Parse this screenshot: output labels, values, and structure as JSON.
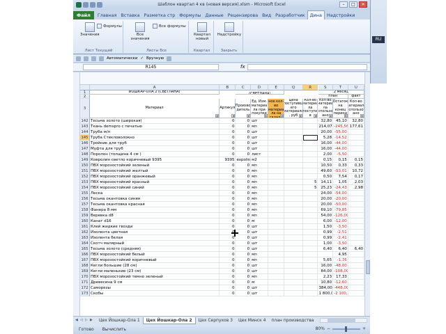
{
  "window": {
    "title": "Шаблон квартал  4 кв (новая версия).xlsm - Microsoft Excel",
    "language": "RU"
  },
  "tabs": [
    "Файл",
    "Главная",
    "Вставка",
    "Разметка стр",
    "Формулы",
    "Данные",
    "Рецензирова",
    "Вид",
    "Разработчик",
    "Дина",
    "Надстройки"
  ],
  "active_tab_index": 9,
  "ribbon": {
    "btn_values": "Значения",
    "btn_formulas": "Формулы",
    "group_current": "Лист Текущий",
    "btn_all_values": "Все значения",
    "btn_all_formulas": "Все формулы",
    "group_all": "Листы Все",
    "btn_quarter_new": "Квартал новый",
    "group_quarter": "Квартал",
    "btn_addin": "Надстройку",
    "group_close": "Закрыть"
  },
  "qbar": {
    "auto_label": "Автоматически",
    "manual_label": "Вручную"
  },
  "formula_bar": {
    "namebox": "R145",
    "fx": "fx",
    "formula": ""
  },
  "grid_head": {
    "store_name": "ЙОШКАР-ОЛА 2 (СВЕТЛАНА)",
    "month": "2 месяц",
    "plan": "план",
    "fact": "факт",
    "col_material": "Материал",
    "col_article": "Артикул",
    "col_maker": "Произво дитель",
    "col_unit": "Ед. Изм. материа ла при покупке",
    "col_min": "Минималь ное кол-во материа ла на складе",
    "col_price": "Цена поступивш его материала , руб",
    "col_qty_in": "Кол-во материа ла поступи в",
    "col_qty_used": "Кол-во материа ла использов ано",
    "col_rest": "Остаток на конец период",
    "col_used_fact": "Кол-во материала использов ано",
    "col_extra": "Ост"
  },
  "col_letters": [
    "A",
    "B",
    "C",
    "D",
    "E",
    "Q",
    "R",
    "S",
    "T",
    "U"
  ],
  "header_rows": [
    "1",
    "2",
    "3"
  ],
  "rows": [
    {
      "n": "142",
      "mat": "Тесьма золото (широкая)",
      "b": "0",
      "c": "0",
      "d": "шт",
      "r": "",
      "s": "32,80",
      "t": "45,10",
      "u": "32,80",
      "tneg": false
    },
    {
      "n": "143",
      "mat": "Ткань  demspro  с печатью",
      "b": "0",
      "c": "0",
      "d": "мп",
      "r": "",
      "s": "214,07",
      "t": "-245,56",
      "u": "177,61",
      "tneg": true
    },
    {
      "n": "144",
      "mat": "Труба м/п",
      "b": "0",
      "c": "0",
      "d": "шт",
      "r": "",
      "s": "20,00",
      "t": "-55,00",
      "u": "",
      "tneg": true
    },
    {
      "n": "145",
      "mat": "Труба Стекловолокно",
      "b": "0",
      "c": "0",
      "d": "шт",
      "r": "",
      "s": "5,28",
      "t": "-14,52",
      "u": "",
      "tneg": true
    },
    {
      "n": "146",
      "mat": "Тройник для  труб",
      "b": "0",
      "c": "0",
      "d": "шт",
      "r": "",
      "s": "16,00",
      "t": "-44,00",
      "u": "",
      "tneg": true
    },
    {
      "n": "147",
      "mat": "Муфта для  труб",
      "b": "0",
      "c": "0",
      "d": "шт",
      "r": "",
      "s": "16,00",
      "t": "-44,00",
      "u": "",
      "tneg": true
    },
    {
      "n": "148",
      "mat": "Поролон (толщина 4 см )",
      "b": "0",
      "c": "0",
      "d": "лист",
      "r": "",
      "s": "2,00",
      "t": "-5,50",
      "u": "",
      "tneg": true
    },
    {
      "n": "149",
      "mat": "Ковролин светло коричневый 9395",
      "b": "9395",
      "c": "expoline",
      "d": "м2",
      "r": "",
      "s": "0,15",
      "t": "0,15",
      "u": "0,15",
      "tneg": false
    },
    {
      "n": "150",
      "mat": "ПВХ  морозостойкий  зеленый",
      "b": "0",
      "c": "0",
      "d": "мп",
      "r": "",
      "s": "10,50",
      "t": "0,33",
      "u": "0,33",
      "tneg": false
    },
    {
      "n": "151",
      "mat": "ПВХ  морозостойкий  желтый",
      "b": "0",
      "c": "0",
      "d": "мп",
      "r": "",
      "s": "49,60",
      "t": "-53,01",
      "u": "10,72",
      "tneg": true
    },
    {
      "n": "152",
      "mat": "ПВХ  морозостойкий  оранжевый",
      "b": "0",
      "c": "0",
      "d": "мп",
      "r": "",
      "s": "0,50",
      "t": "7,54",
      "u": "0,17",
      "tneg": false
    },
    {
      "n": "153",
      "mat": "ПВХ морозостойкий  красный",
      "b": "0",
      "c": "0",
      "d": "мп",
      "r": "5",
      "s": "14,11",
      "t": "1,05",
      "u": "2,03",
      "tneg": false
    },
    {
      "n": "154",
      "mat": "ПВХ морозостойкий синий",
      "b": "0",
      "c": "0",
      "d": "мп",
      "r": "5",
      "s": "25,23",
      "t": "-24,43",
      "u": "2,98",
      "tneg": true
    },
    {
      "n": "155",
      "mat": "Леска",
      "b": "0",
      "c": "0",
      "d": "мп",
      "r": "",
      "s": "24,00",
      "t": "-54,00",
      "u": "",
      "tneg": true
    },
    {
      "n": "156",
      "mat": "Тесьма  окантовка синяя",
      "b": "0",
      "c": "0",
      "d": "мп",
      "r": "",
      "s": "20,00",
      "t": "-20,00",
      "u": "",
      "tneg": true
    },
    {
      "n": "157",
      "mat": "Тесьма окантовка красная",
      "b": "0",
      "c": "0",
      "d": "мп",
      "r": "",
      "s": "20,00",
      "t": "-50,00",
      "u": "",
      "tneg": true
    },
    {
      "n": "158",
      "mat": "Фанера 8 мм",
      "b": "0",
      "c": "0",
      "d": "мп",
      "r": "",
      "s": "69,10",
      "t": "-79,85",
      "u": "",
      "tneg": true
    },
    {
      "n": "159",
      "mat": "Веревка d8",
      "b": "0",
      "c": "0",
      "d": "мп",
      "r": "",
      "s": "54,00",
      "t": "-126,00",
      "u": "",
      "tneg": true
    },
    {
      "n": "160",
      "mat": "Канат d16",
      "b": "0",
      "c": "0",
      "d": "м",
      "r": "",
      "s": "6,00",
      "t": "-12,00",
      "u": "",
      "tneg": true
    },
    {
      "n": "161",
      "mat": "Клей жидкие гвозди",
      "b": "0",
      "c": "0",
      "d": "шт",
      "r": "",
      "s": "1,50",
      "t": "-3,50",
      "u": "",
      "tneg": true
    },
    {
      "n": "162",
      "mat": "Изолента цветная",
      "b": "0",
      "c": "0",
      "d": "шт",
      "r": "",
      "s": "0,99",
      "t": "-2,51",
      "u": "",
      "tneg": true
    },
    {
      "n": "163",
      "mat": "Изолента белая",
      "b": "0",
      "c": "0",
      "d": "шт",
      "r": "",
      "s": "0,99",
      "t": "-2,41",
      "u": "",
      "tneg": true
    },
    {
      "n": "164",
      "mat": "Скотч малярный",
      "b": "0",
      "c": "0",
      "d": "шт",
      "r": "",
      "s": "1,00",
      "t": "-3,50",
      "u": "",
      "tneg": true
    },
    {
      "n": "165",
      "mat": "Тесьма золото (средняя)",
      "b": "0",
      "c": "0",
      "d": "шт",
      "r": "",
      "s": "6,40",
      "t": "6,40",
      "u": "6,40",
      "tneg": false
    },
    {
      "n": "166",
      "mat": "ПВХ морозостойкий  белый",
      "b": "0",
      "c": "0",
      "d": "мп",
      "r": "",
      "s": "",
      "t": "4,95",
      "u": "",
      "tneg": false
    },
    {
      "n": "167",
      "mat": "ПВХ морозостойкий коричневый",
      "b": "0",
      "c": "0",
      "d": "мп",
      "r": "",
      "s": "5,65",
      "t": "-1,76",
      "u": "",
      "tneg": true
    },
    {
      "n": "168",
      "mat": "Кегли большие (28 см)",
      "b": "0",
      "c": "0",
      "d": "шт",
      "r": "",
      "s": "16,00",
      "t": "-48,00",
      "u": "",
      "tneg": true
    },
    {
      "n": "169",
      "mat": "Кегли маленькие (23 см)",
      "b": "0",
      "c": "0",
      "d": "шт",
      "r": "",
      "s": "84,00",
      "t": "-108,00",
      "u": "",
      "tneg": true
    },
    {
      "n": "170",
      "mat": "ПВХ морозостойкий темно зеленый",
      "b": "0",
      "c": "0",
      "d": "мп",
      "r": "",
      "s": "2,23",
      "t": "17,33",
      "u": "",
      "tneg": false
    },
    {
      "n": "171",
      "mat": "Древесина  9 см",
      "b": "0",
      "c": "0",
      "d": "м",
      "r": "",
      "s": "10,80",
      "t": "-12,60",
      "u": "",
      "tneg": true
    },
    {
      "n": "172",
      "mat": "Саморезы",
      "b": "0",
      "c": "0",
      "d": "шт",
      "r": "",
      "s": "384,00",
      "t": "-448,00",
      "u": "",
      "tneg": true
    },
    {
      "n": "173",
      "mat": "Скобы",
      "b": "0",
      "c": "0",
      "d": "шт",
      "r": "",
      "s": "1 800,00",
      "t": "-2 100,00",
      "u": "",
      "tneg": true
    }
  ],
  "sheets": [
    "Цех Йошкар-Ола 1",
    "Цех Йошкар-Ола 2",
    "Цех Серпухов 3",
    "Цех Минск 4",
    "план производства"
  ],
  "active_sheet_index": 1,
  "status": {
    "ready": "Готово",
    "calc": "Вычислить",
    "zoom": "80%"
  },
  "colors": {
    "accent_orange": "#f7b74a",
    "negative": "#d21f1f",
    "file_tab": "#2e7d32"
  }
}
